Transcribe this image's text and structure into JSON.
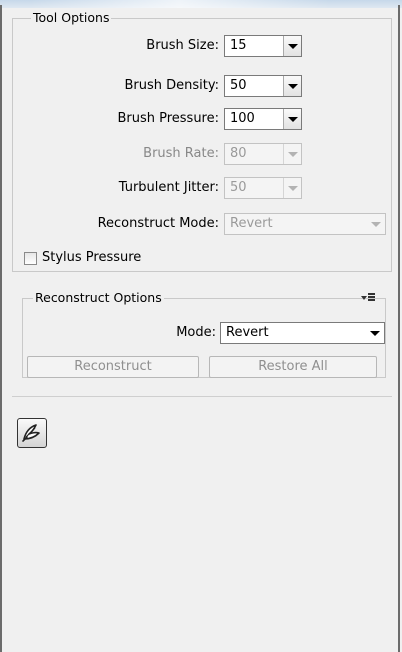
{
  "tool_options": {
    "title": "Tool Options",
    "rows": [
      {
        "label": "Brush Size:",
        "value": "15",
        "enabled": true
      },
      {
        "label": "Brush Density:",
        "value": "50",
        "enabled": true
      },
      {
        "label": "Brush Pressure:",
        "value": "100",
        "enabled": true
      },
      {
        "label": "Brush Rate:",
        "value": "80",
        "enabled": false
      },
      {
        "label": "Turbulent Jitter:",
        "value": "50",
        "enabled": false
      }
    ],
    "reconstruct_mode": {
      "label": "Reconstruct Mode:",
      "value": "Revert",
      "enabled": false
    },
    "stylus_pressure": {
      "label": "Stylus Pressure",
      "checked": false
    }
  },
  "reconstruct_options": {
    "title": "Reconstruct Options",
    "mode_label": "Mode:",
    "mode_value": "Revert",
    "reconstruct_button": "Reconstruct",
    "restore_all_button": "Restore All"
  },
  "tool_icon": "reconstruct-tool-icon"
}
